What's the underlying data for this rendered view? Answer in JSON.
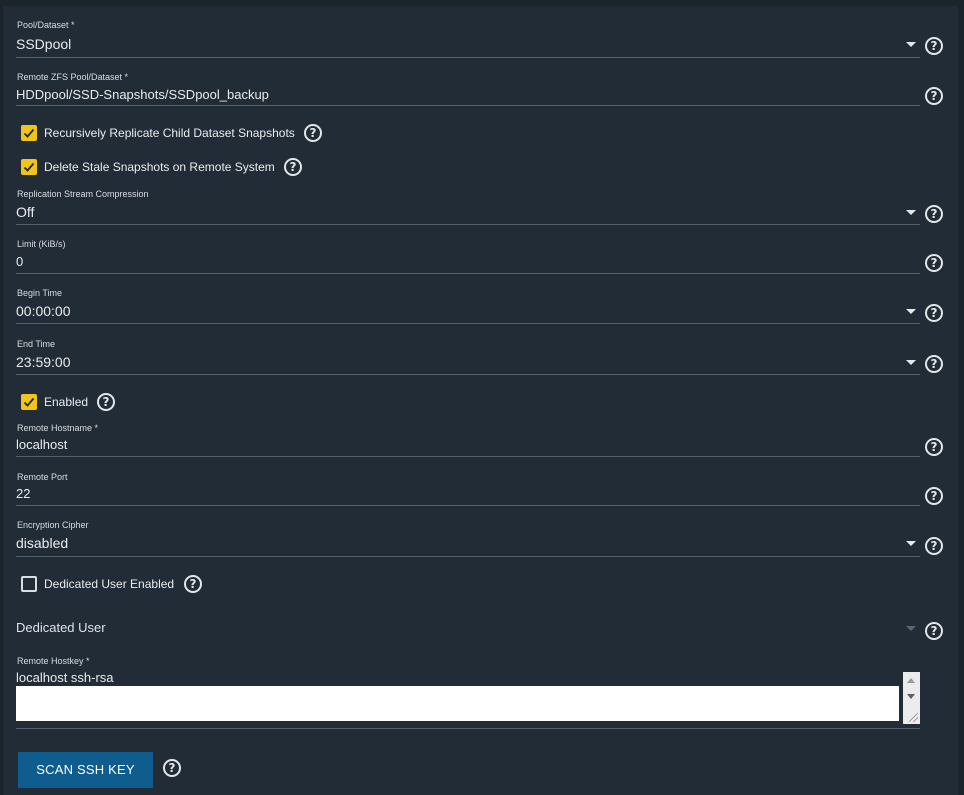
{
  "fields": {
    "pool_dataset": {
      "label": "Pool/Dataset *",
      "value": "SSDpool"
    },
    "remote_zfs": {
      "label": "Remote ZFS Pool/Dataset *",
      "value": "HDDpool/SSD-Snapshots/SSDpool_backup"
    },
    "compression": {
      "label": "Replication Stream Compression",
      "value": "Off"
    },
    "limit": {
      "label": "Limit (KiB/s)",
      "value": "0"
    },
    "begin_time": {
      "label": "Begin Time",
      "value": "00:00:00"
    },
    "end_time": {
      "label": "End Time",
      "value": "23:59:00"
    },
    "remote_hostname": {
      "label": "Remote Hostname *",
      "value": "localhost"
    },
    "remote_port": {
      "label": "Remote Port",
      "value": "22"
    },
    "encryption_cipher": {
      "label": "Encryption Cipher",
      "value": "disabled"
    },
    "dedicated_user": {
      "placeholder": "Dedicated User"
    },
    "remote_hostkey": {
      "label": "Remote Hostkey *",
      "value": "localhost ssh-rsa"
    }
  },
  "checkboxes": {
    "recursive": {
      "label": "Recursively Replicate Child Dataset Snapshots",
      "checked": true
    },
    "delete_stale": {
      "label": "Delete Stale Snapshots on Remote System",
      "checked": true
    },
    "enabled": {
      "label": "Enabled",
      "checked": true
    },
    "dedicated_user_enabled": {
      "label": "Dedicated User Enabled",
      "checked": false
    }
  },
  "buttons": {
    "scan_ssh_key": "SCAN SSH KEY"
  },
  "help_glyph": "?",
  "colors": {
    "background": "#222c36",
    "checkbox_accent": "#f0c419",
    "primary_button": "#0f5c8f"
  }
}
